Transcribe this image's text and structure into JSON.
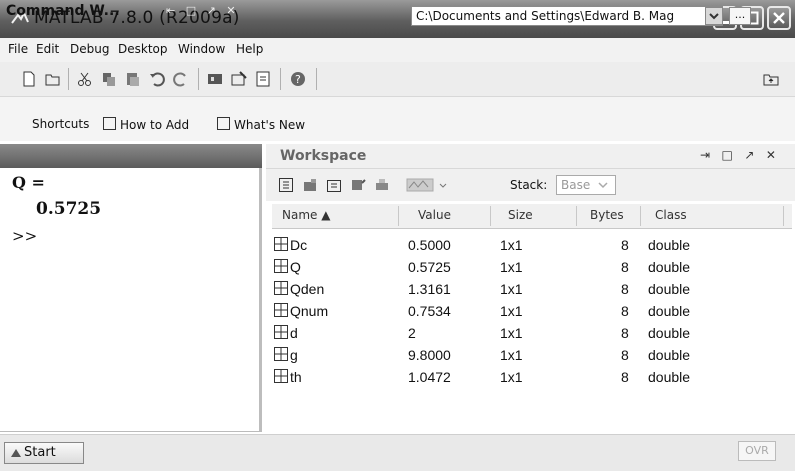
{
  "window": {
    "title": "MATLAB  7.8.0 (R2009a)"
  },
  "menu": [
    "File",
    "Edit",
    "Debug",
    "Desktop",
    "Window",
    "Help"
  ],
  "toolbar": {
    "current_directory": "C:\\Documents and Settings\\Edward B. Mag",
    "browse_label": "..."
  },
  "shortcuts": {
    "shortcuts_label": "Shortcuts",
    "how_to_add": "How to Add",
    "whats_new": "What's New"
  },
  "command_window": {
    "title": "Command W...",
    "lines": [
      "Q =",
      "0.5725",
      ">>"
    ]
  },
  "workspace": {
    "title": "Workspace",
    "stack_label": "Stack:",
    "stack_value": "Base",
    "columns": [
      "Name ▲",
      "Value",
      "Size",
      "Bytes",
      "Class"
    ],
    "rows": [
      {
        "name": "Dc",
        "value": "0.5000",
        "size": "1x1",
        "bytes": "8",
        "class": "double"
      },
      {
        "name": "Q",
        "value": "0.5725",
        "size": "1x1",
        "bytes": "8",
        "class": "double"
      },
      {
        "name": "Qden",
        "value": "1.3161",
        "size": "1x1",
        "bytes": "8",
        "class": "double"
      },
      {
        "name": "Qnum",
        "value": "0.7534",
        "size": "1x1",
        "bytes": "8",
        "class": "double"
      },
      {
        "name": "d",
        "value": "2",
        "size": "1x1",
        "bytes": "8",
        "class": "double"
      },
      {
        "name": "g",
        "value": "9.8000",
        "size": "1x1",
        "bytes": "8",
        "class": "double"
      },
      {
        "name": "th",
        "value": "1.0472",
        "size": "1x1",
        "bytes": "8",
        "class": "double"
      }
    ]
  },
  "status": {
    "start_label": "Start",
    "ovr": "OVR"
  }
}
